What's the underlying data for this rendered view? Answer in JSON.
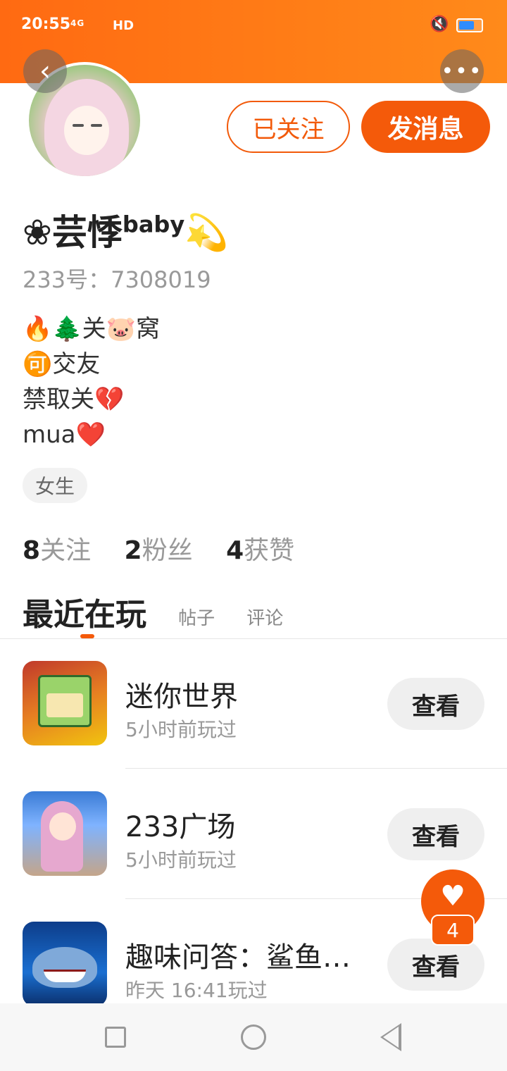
{
  "status_bar": {
    "time": "20:55",
    "network": "4G",
    "hd": "HD",
    "mute": "🔇",
    "battery_level": 0.7
  },
  "top_nav": {
    "back_glyph": "‹",
    "more_glyph": "•••"
  },
  "profile": {
    "follow_label": "已关注",
    "message_label": "发消息",
    "username": "❀芸悸",
    "username_sup": "baby",
    "username_emoji": "💫",
    "id_label": "233号：7308019",
    "bio": [
      "🔥🌲关🐷窝",
      "🉑交友",
      "禁取关💔",
      "mua❤️"
    ],
    "gender": "女生",
    "stats": [
      {
        "num": "8",
        "label": "关注"
      },
      {
        "num": "2",
        "label": "粉丝"
      },
      {
        "num": "4",
        "label": "获赞"
      }
    ]
  },
  "tabs": {
    "active": "最近在玩",
    "posts": "帖子",
    "comments": "评论"
  },
  "games": [
    {
      "name": "迷你世界",
      "time": "5小时前玩过",
      "button": "查看"
    },
    {
      "name": "233广场",
      "time": "5小时前玩过",
      "button": "查看"
    },
    {
      "name": "趣味问答：鲨鱼…",
      "time": "昨天 16:41玩过",
      "button": "查看"
    }
  ],
  "like_float": {
    "heart": "♥",
    "count": "4"
  },
  "colors": {
    "accent": "#f45a0a",
    "header_gradient_start": "#ff6a12",
    "header_gradient_end": "#ff8a1a"
  }
}
